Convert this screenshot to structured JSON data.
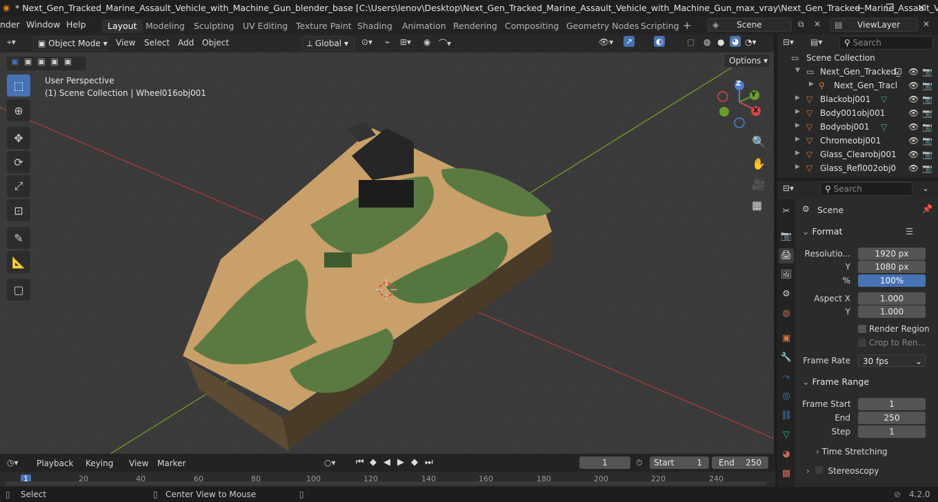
{
  "title_bar": {
    "title": "* Next_Gen_Tracked_Marine_Assault_Vehicle_with_Machine_Gun_blender_base [C:\\Users\\lenov\\Desktop\\Next_Gen_Tracked_Marine_Assault_Vehicle_with_Machine_Gun_max_vray\\Next_Gen_Tracked_Marine_Assault_Vehicle_wit...",
    "minimize": "—",
    "maximize": "❐",
    "close": "✕"
  },
  "menu": [
    "nder",
    "Window",
    "Help"
  ],
  "workspaces": [
    "Layout",
    "Modeling",
    "Sculpting",
    "UV Editing",
    "Texture Paint",
    "Shading",
    "Animation",
    "Rendering",
    "Compositing",
    "Geometry Nodes",
    "Scripting"
  ],
  "active_workspace": "Layout",
  "scene_name": "Scene",
  "view_layer": "ViewLayer",
  "viewport_header": {
    "mode": "Object Mode",
    "menus": [
      "View",
      "Select",
      "Add",
      "Object"
    ],
    "orientation": "Global",
    "options": "Options"
  },
  "viewport": {
    "perspective": "User Perspective",
    "collection_info": "(1) Scene Collection | Wheel016obj001",
    "gizmo_axes": [
      "Z",
      "Y",
      "X"
    ]
  },
  "outliner": {
    "search_placeholder": "Search",
    "root": "Scene Collection",
    "rows": [
      {
        "label": "Next_Gen_Tracked_",
        "level": 1
      },
      {
        "label": "Next_Gen_Tracl",
        "level": 2
      },
      {
        "label": "Blackobj001",
        "level": 1
      },
      {
        "label": "Body001obj001",
        "level": 1
      },
      {
        "label": "Bodyobj001",
        "level": 1
      },
      {
        "label": "Chromeobj001",
        "level": 1
      },
      {
        "label": "Glass_Clearobj001",
        "level": 1
      },
      {
        "label": "Glass_Refl002obj0",
        "level": 1
      }
    ]
  },
  "properties": {
    "search_placeholder": "Search",
    "context": "Scene",
    "format": {
      "header": "Format",
      "resolution_label": "Resolutio...",
      "res_x": "1920 px",
      "y_label": "Y",
      "res_y": "1080 px",
      "pct_label": "%",
      "pct": "100%",
      "aspect_label": "Aspect X",
      "aspect_x": "1.000",
      "aspect_y": "1.000",
      "render_region": "Render Region",
      "crop": "Crop to Ren...",
      "fps_label": "Frame Rate",
      "fps": "30 fps"
    },
    "frame_range": {
      "header": "Frame Range",
      "start_label": "Frame Start",
      "start": "1",
      "end_label": "End",
      "end": "250",
      "step_label": "Step",
      "step": "1",
      "time_stretching": "Time Stretching"
    },
    "stereoscopy": "Stereoscopy"
  },
  "timeline": {
    "menus": [
      "Playback",
      "Keying",
      "View",
      "Marker"
    ],
    "current_frame": "1",
    "start_label": "Start",
    "start": "1",
    "end_label": "End",
    "end": "250",
    "ticks": [
      "1",
      "20",
      "40",
      "60",
      "80",
      "100",
      "120",
      "140",
      "160",
      "180",
      "200",
      "220",
      "240"
    ]
  },
  "status_bar": {
    "select": "Select",
    "center": "Center View to Mouse",
    "version": "4.2.0"
  }
}
